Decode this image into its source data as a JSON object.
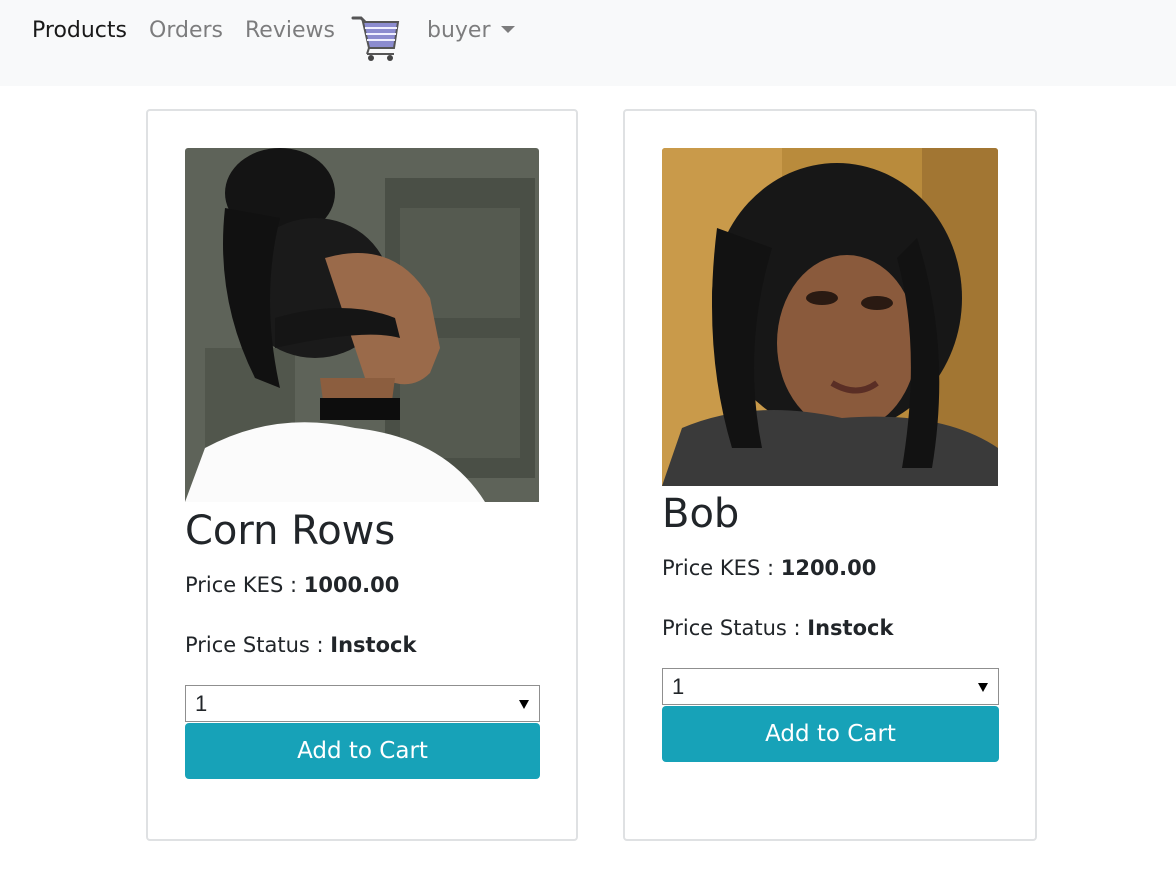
{
  "navbar": {
    "links": [
      {
        "label": "Products",
        "active": true
      },
      {
        "label": "Orders",
        "active": false
      },
      {
        "label": "Reviews",
        "active": false
      }
    ],
    "cart_icon": "shopping-cart-icon",
    "user_menu": {
      "label": "buyer",
      "icon": "caret-down-icon"
    }
  },
  "products": [
    {
      "name": "Corn Rows",
      "price_label": "Price KES :",
      "price": "1000.00",
      "status_label": "Price Status :",
      "status": "Instock",
      "quantity": "1",
      "button_label": "Add to Cart"
    },
    {
      "name": "Bob",
      "price_label": "Price KES :",
      "price": "1200.00",
      "status_label": "Price Status :",
      "status": "Instock",
      "quantity": "1",
      "button_label": "Add to Cart"
    }
  ],
  "colors": {
    "navbar_bg": "#f8f9fa",
    "button_bg": "#17a2b8",
    "card_border": "#dfe1e3"
  }
}
